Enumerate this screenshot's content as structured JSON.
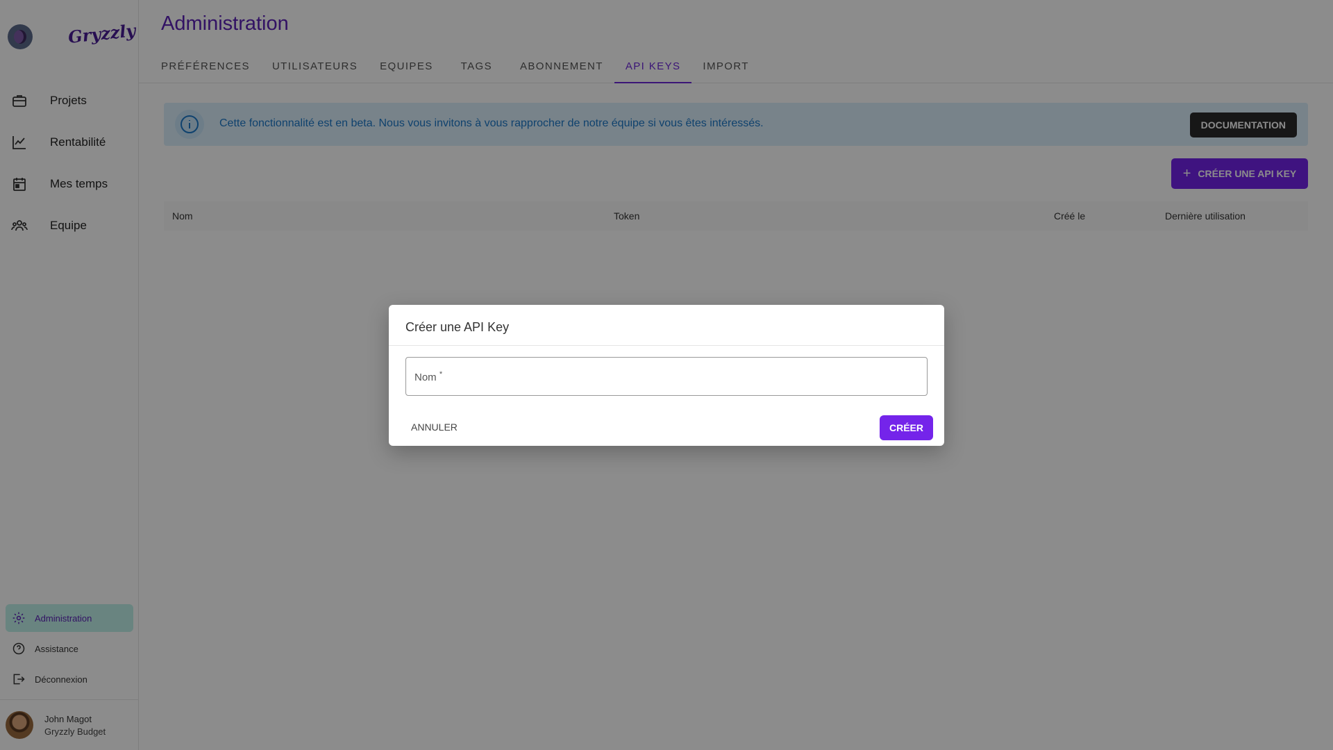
{
  "brand": {
    "logo_text": "Gryzzly"
  },
  "sidebar": {
    "items": [
      {
        "label": "Projets",
        "icon": "briefcase-icon"
      },
      {
        "label": "Rentabilité",
        "icon": "chart-line-icon"
      },
      {
        "label": "Mes temps",
        "icon": "calendar-icon"
      },
      {
        "label": "Equipe",
        "icon": "users-icon"
      }
    ],
    "bottom_items": [
      {
        "label": "Administration",
        "icon": "gear-icon",
        "active": true
      },
      {
        "label": "Assistance",
        "icon": "help-icon"
      },
      {
        "label": "Déconnexion",
        "icon": "logout-icon"
      }
    ],
    "user": {
      "name": "John Magot",
      "org": "Gryzzly Budget"
    }
  },
  "header": {
    "title": "Administration",
    "tabs": [
      "Préférences",
      "Utilisateurs",
      "Equipes",
      "Tags",
      "Abonnement",
      "API Keys",
      "Import"
    ],
    "active_tab": "API Keys"
  },
  "alert": {
    "text": "Cette fonctionnalité est en beta. Nous vous invitons à vous rapprocher de notre équipe si vous êtes intéressés.",
    "button": "DOCUMENTATION"
  },
  "create_button": "CRÉER UNE API KEY",
  "table": {
    "columns": [
      "Nom",
      "Token",
      "Créé le",
      "Dernière utilisation"
    ]
  },
  "dialog": {
    "title": "Créer une API Key",
    "name_label": "Nom",
    "required_mark": "*",
    "name_value": "",
    "cancel": "ANNULER",
    "submit": "CRÉER"
  },
  "colors": {
    "accent": "#7424ea",
    "active_nav": "#bff1e9",
    "alert_bg": "#dbeefb"
  }
}
